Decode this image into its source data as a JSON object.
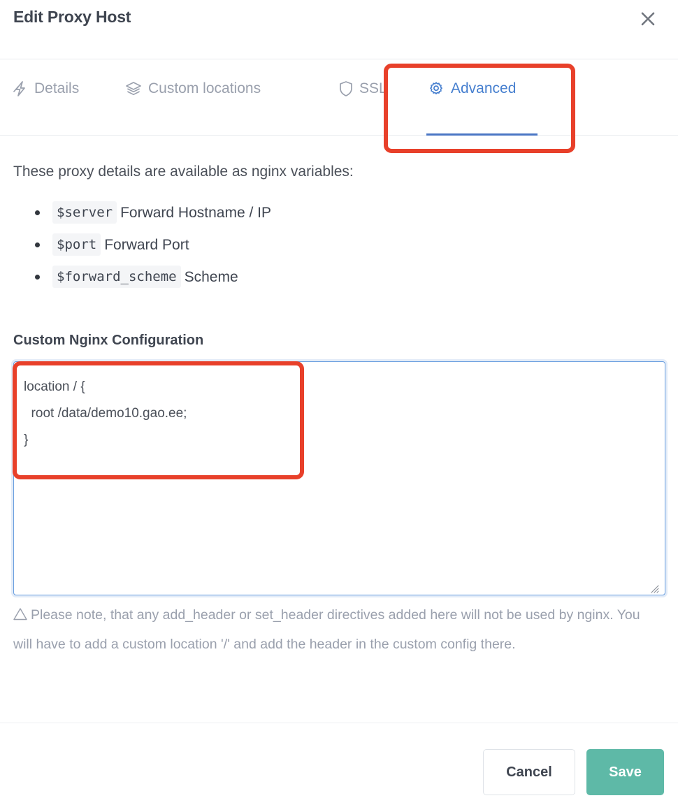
{
  "header": {
    "title": "Edit Proxy Host",
    "close_icon": "close-icon"
  },
  "tabs": [
    {
      "label": "Details",
      "icon": "lightning-bolt-icon",
      "active": false
    },
    {
      "label": "Custom locations",
      "icon": "layers-icon",
      "active": false
    },
    {
      "label": "SSL",
      "icon": "shield-icon",
      "active": false
    },
    {
      "label": "Advanced",
      "icon": "gear-icon",
      "active": true
    }
  ],
  "body": {
    "intro": "These proxy details are available as nginx variables:",
    "variables": [
      {
        "code": "$server",
        "desc": "Forward Hostname / IP"
      },
      {
        "code": "$port",
        "desc": "Forward Port"
      },
      {
        "code": "$forward_scheme",
        "desc": "Scheme"
      }
    ],
    "config_label": "Custom Nginx Configuration",
    "config_value": "location / {\n  root /data/demo10.gao.ee;\n}",
    "config_placeholder": "",
    "note_icon": "warning-triangle-icon",
    "note": "Please note, that any add_header or set_header directives added here will not be used by nginx. You will have to add a custom location '/' and add the header in the custom config there."
  },
  "footer": {
    "cancel_label": "Cancel",
    "save_label": "Save"
  },
  "annotations": [
    {
      "name": "advanced-tab-highlight",
      "color": "#e8402a"
    },
    {
      "name": "custom-config-highlight",
      "color": "#e8402a"
    }
  ],
  "colors": {
    "accent_blue": "#467fcf",
    "save_teal": "#5eb9a7",
    "annotation_red": "#e8402a",
    "muted_text": "#9aa0ad",
    "dark_text": "#3f4550"
  }
}
